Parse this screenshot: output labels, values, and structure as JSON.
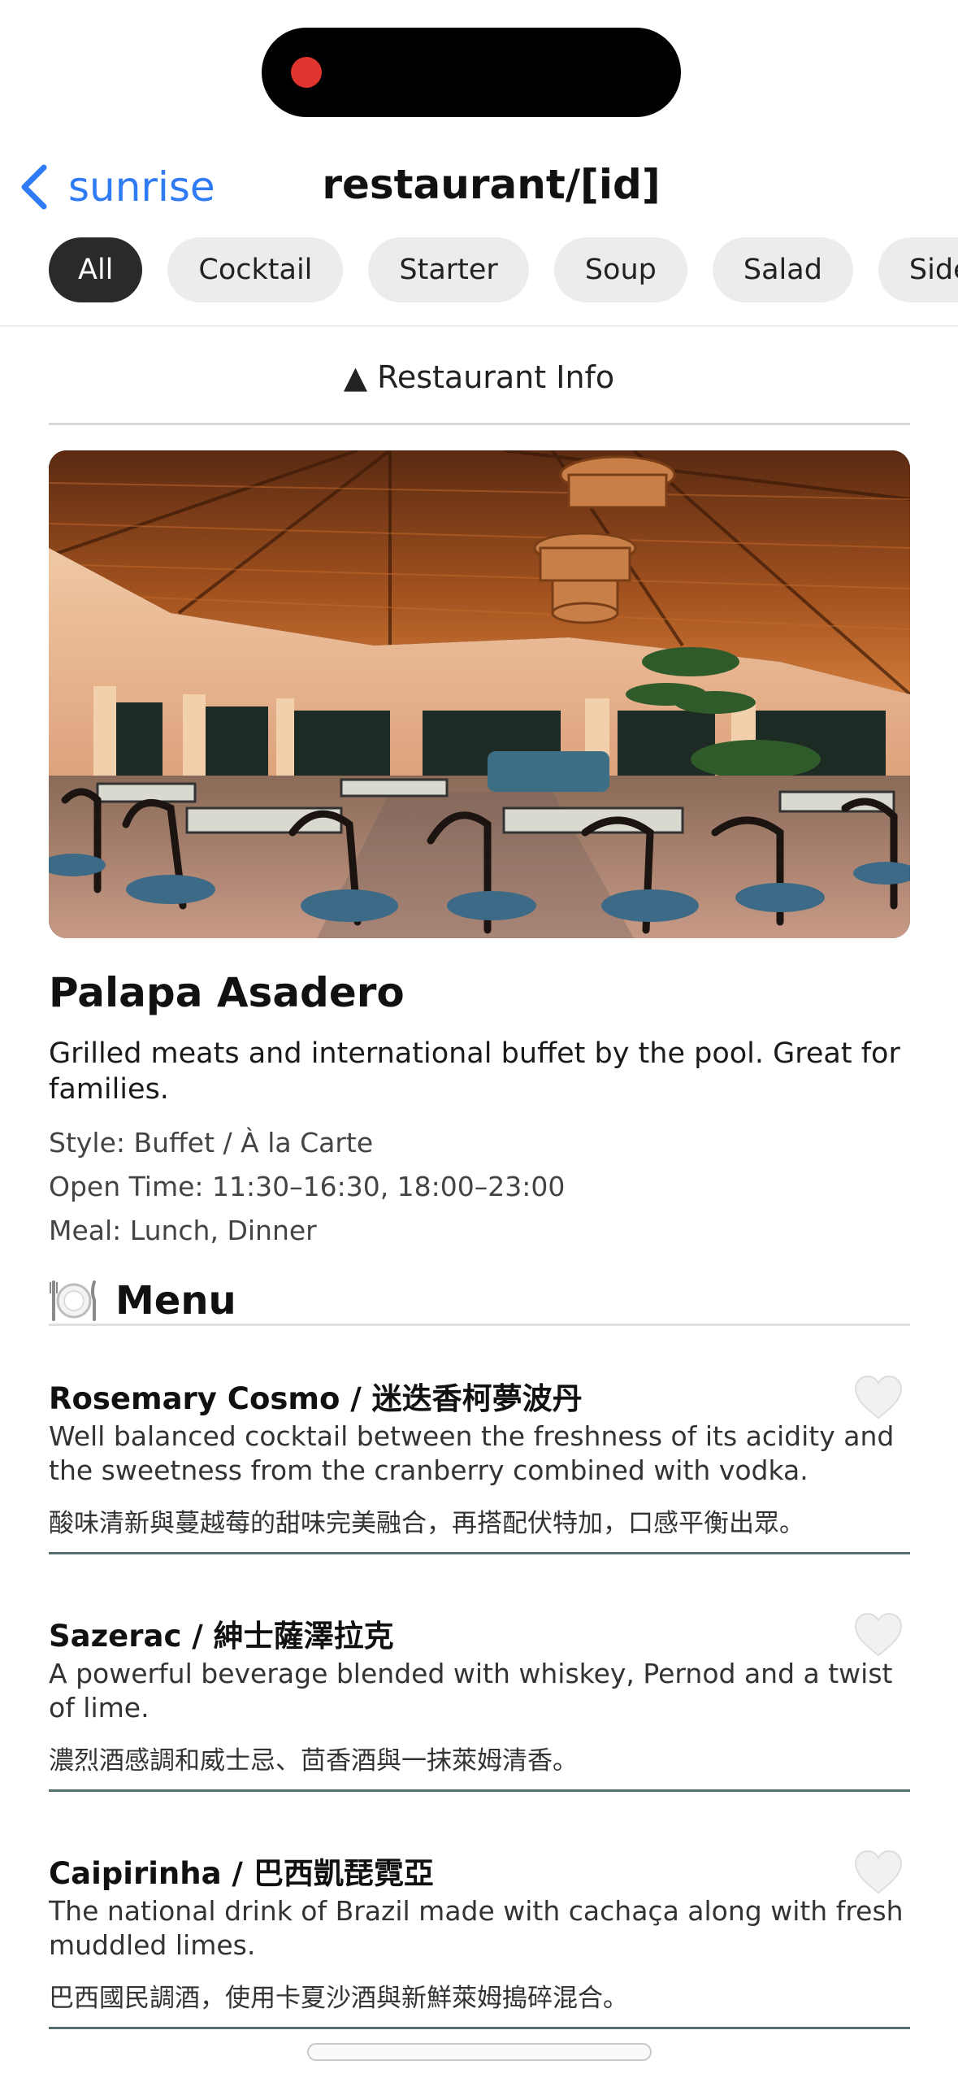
{
  "navigation": {
    "back_label": "sunrise",
    "title": "restaurant/[id]"
  },
  "categories": [
    "All",
    "Cocktail",
    "Starter",
    "Soup",
    "Salad",
    "Side"
  ],
  "active_category": "All",
  "info_toggle": "▲ Restaurant Info",
  "restaurant": {
    "name": "Palapa Asadero",
    "description": "Grilled meats and international buffet by the pool. Great for families.",
    "style": "Style: Buffet / À la Carte",
    "open_time": "Open Time: 11:30–16:30, 18:00–23:00",
    "meal": "Meal: Lunch, Dinner"
  },
  "menu": {
    "icon": "🍽️",
    "title": "Menu",
    "items": [
      {
        "name": "Rosemary Cosmo / 迷迭香柯夢波丹",
        "description": "Well balanced cocktail between the freshness of its acidity and the sweetness from the cranberry combined with vodka.",
        "description_zh": "酸味清新與蔓越莓的甜味完美融合，再搭配伏特加，口感平衡出眾。"
      },
      {
        "name": "Sazerac / 紳士薩澤拉克",
        "description": "A powerful beverage blended with whiskey, Pernod and a twist of lime.",
        "description_zh": "濃烈酒感調和威士忌、茴香酒與一抹萊姆清香。"
      },
      {
        "name": "Caipirinha / 巴西凱琵霓亞",
        "description": "The national drink of Brazil made with cachaça along with fresh muddled limes.",
        "description_zh": "巴西國民調酒，使用卡夏沙酒與新鮮萊姆搗碎混合。"
      }
    ]
  },
  "colors": {
    "accent": "#2f7bf5",
    "chip_active_bg": "#2a2a2c",
    "chip_bg": "#ececee",
    "item_divider": "#54706c",
    "recording_dot": "#e0342e"
  }
}
